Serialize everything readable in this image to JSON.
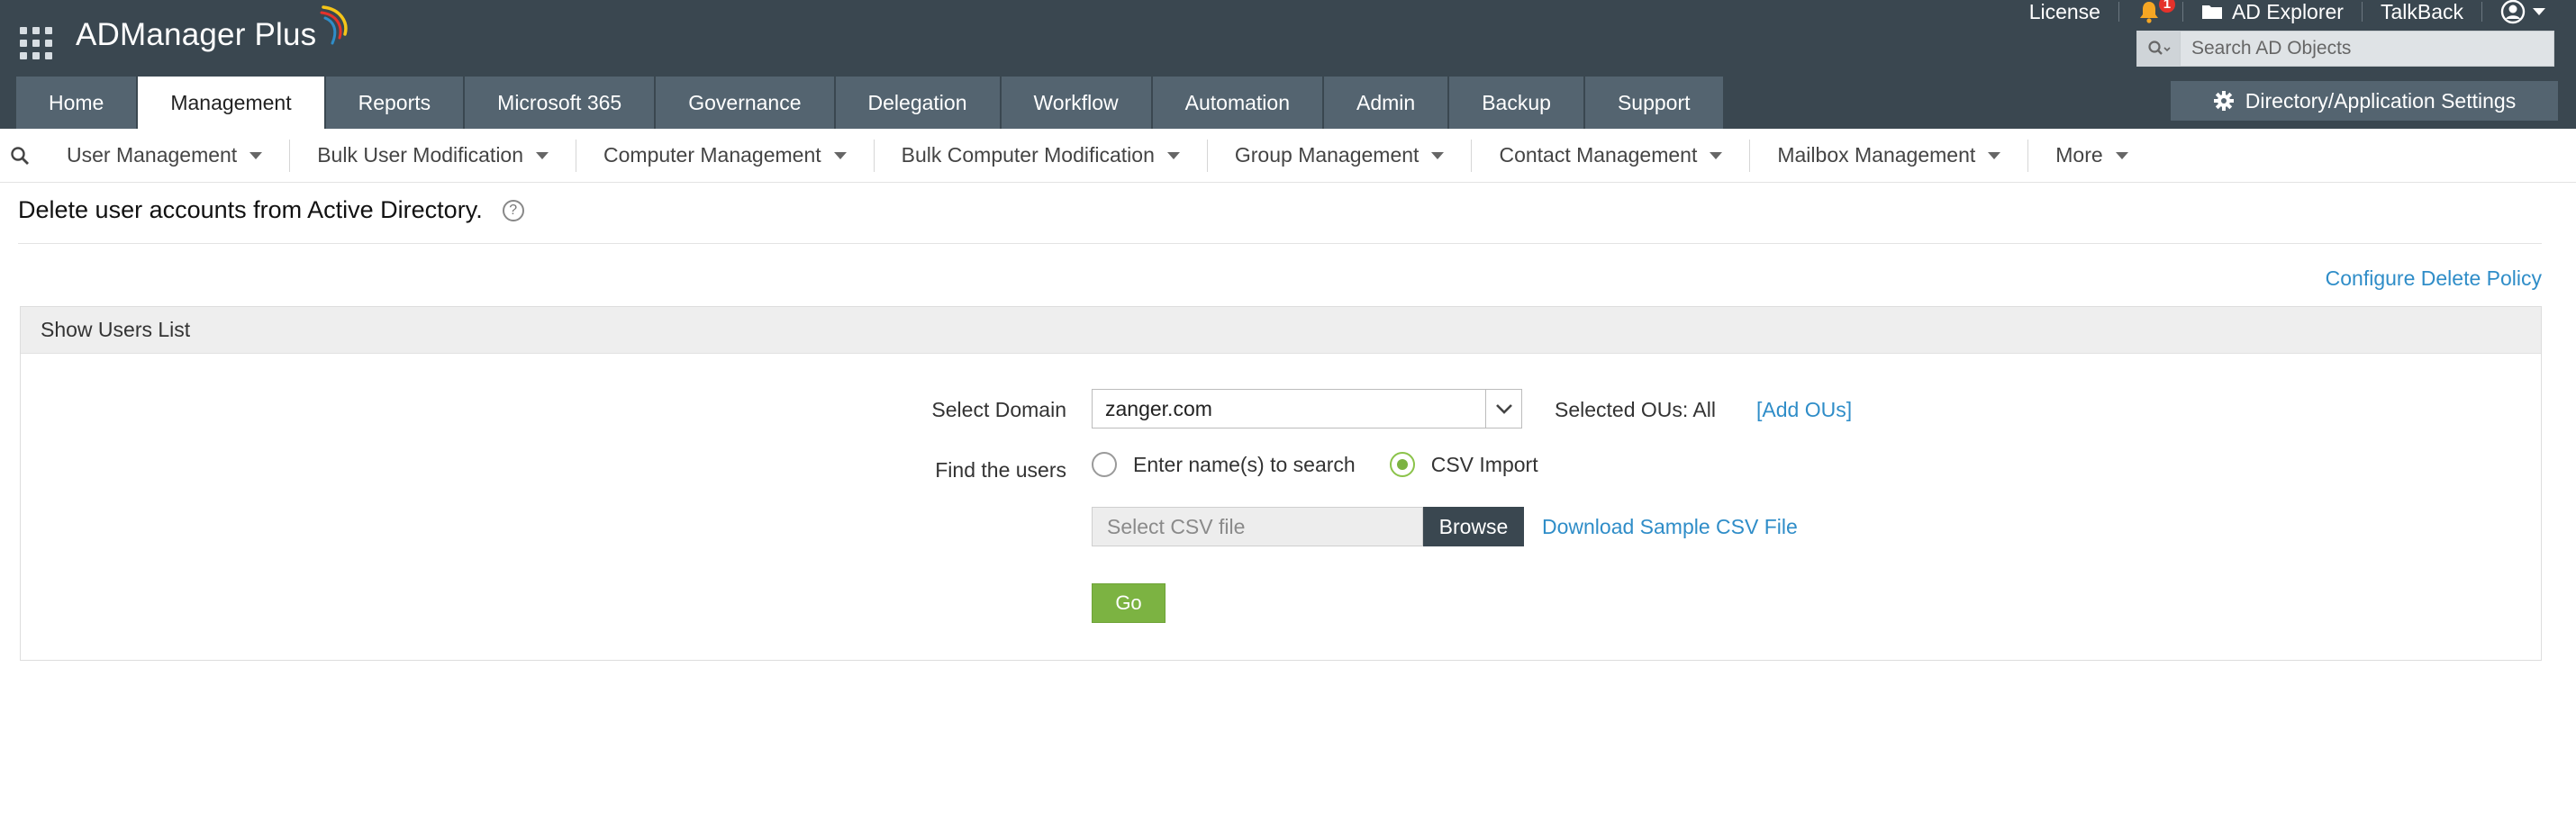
{
  "brand": {
    "app_name": "ADManager Plus",
    "swoosh_colors": [
      "#f5c518",
      "#e5322b",
      "#2f8dc8"
    ]
  },
  "top_links": {
    "license": "License",
    "notifications_badge": "1",
    "ad_explorer": "AD Explorer",
    "talkback": "TalkBack"
  },
  "search": {
    "placeholder": "Search AD Objects"
  },
  "tabs": [
    {
      "label": "Home",
      "active": false
    },
    {
      "label": "Management",
      "active": true
    },
    {
      "label": "Reports",
      "active": false
    },
    {
      "label": "Microsoft 365",
      "active": false
    },
    {
      "label": "Governance",
      "active": false
    },
    {
      "label": "Delegation",
      "active": false
    },
    {
      "label": "Workflow",
      "active": false
    },
    {
      "label": "Automation",
      "active": false
    },
    {
      "label": "Admin",
      "active": false
    },
    {
      "label": "Backup",
      "active": false
    },
    {
      "label": "Support",
      "active": false
    }
  ],
  "settings_button": "Directory/Application Settings",
  "subnav": [
    {
      "label": "User Management"
    },
    {
      "label": "Bulk User Modification"
    },
    {
      "label": "Computer Management"
    },
    {
      "label": "Bulk Computer Modification"
    },
    {
      "label": "Group Management"
    },
    {
      "label": "Contact Management"
    },
    {
      "label": "Mailbox Management"
    },
    {
      "label": "More"
    }
  ],
  "page": {
    "title": "Delete user accounts from Active Directory.",
    "help_glyph": "?",
    "configure_link": "Configure Delete Policy"
  },
  "panel": {
    "header": "Show Users List",
    "select_domain_label": "Select Domain",
    "domain_value": "zanger.com",
    "selected_ous_text": "Selected OUs: All",
    "add_ous_link": "[Add OUs]",
    "find_users_label": "Find the users",
    "radio_options": [
      {
        "label": "Enter name(s) to search",
        "checked": false
      },
      {
        "label": "CSV Import",
        "checked": true
      }
    ],
    "csv_placeholder": "Select CSV file",
    "browse_button": "Browse",
    "download_link": "Download Sample CSV File",
    "go_button": "Go"
  },
  "colors": {
    "header_bg": "#3a4750",
    "tab_bg": "#546470",
    "link_blue": "#2f8dc8",
    "go_green": "#7cb342",
    "badge_red": "#e5322b"
  }
}
